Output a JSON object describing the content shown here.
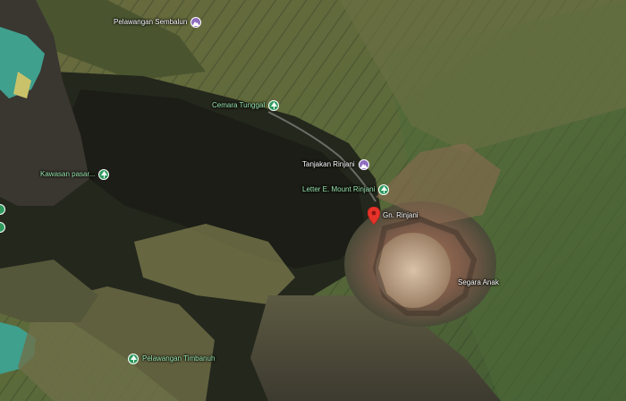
{
  "map": {
    "type": "satellite",
    "colors": {
      "mountain_pin": "#8e6cbf",
      "park_pin": "#2e9a5e",
      "selected_pin": "#e5332a",
      "lake": "#3fa08e"
    }
  },
  "places": {
    "pelawangan_sembalun": {
      "name": "Pelawangan Sembalun",
      "icon": "mountain-icon"
    },
    "cemara_tunggal": {
      "name": "Cemara Tunggal",
      "icon": "park-icon"
    },
    "tanjakan_rinjani": {
      "name": "Tanjakan Rinjani",
      "icon": "mountain-icon"
    },
    "letter_e_mount_rinjani": {
      "name": "Letter E. Mount Rinjani",
      "icon": "park-icon"
    },
    "gn_rinjani": {
      "name": "Gn. Rinjani",
      "icon": "red-location-pin"
    },
    "kawasan_pasar": {
      "name": "Kawasan pasar...",
      "icon": "park-icon"
    },
    "segara_anak": {
      "name": "Segara Anak"
    },
    "pelawangan_timbanuh": {
      "name": "Pelawangan Timbanuh",
      "icon": "park-icon"
    }
  }
}
